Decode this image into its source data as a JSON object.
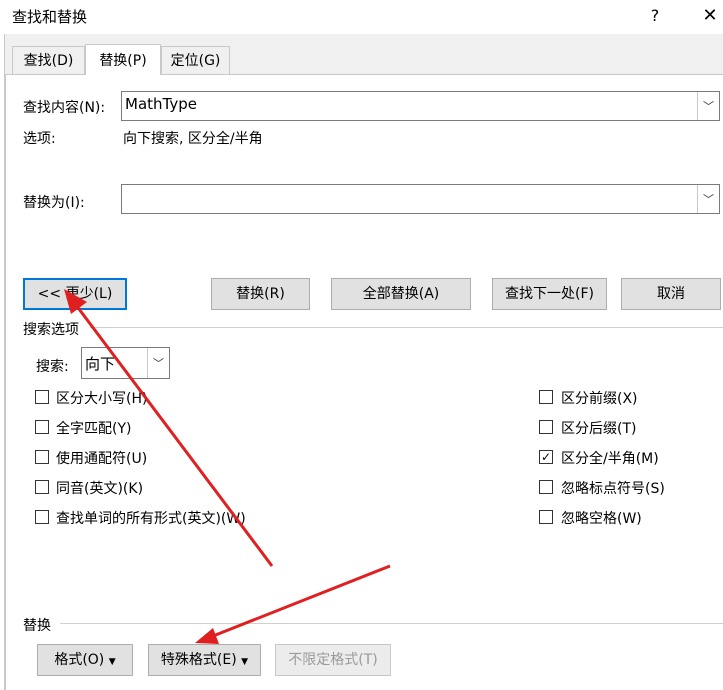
{
  "window": {
    "title": "查找和替换",
    "help": "?",
    "close": "✕"
  },
  "tabs": [
    {
      "label": "查找(D)",
      "active": false
    },
    {
      "label": "替换(P)",
      "active": true
    },
    {
      "label": "定位(G)",
      "active": false
    }
  ],
  "find": {
    "label": "查找内容(N):",
    "value": "MathType",
    "options_label": "选项:",
    "options_value": "向下搜索, 区分全/半角"
  },
  "replace": {
    "label": "替换为(I):",
    "value": ""
  },
  "buttons": {
    "less": "<< 更少(L)",
    "replace": "替换(R)",
    "replace_all": "全部替换(A)",
    "find_next": "查找下一处(F)",
    "cancel": "取消"
  },
  "search_options": {
    "title": "搜索选项",
    "search_label": "搜索:",
    "search_value": "向下",
    "left": [
      {
        "label": "区分大小写(H)",
        "checked": false
      },
      {
        "label": "全字匹配(Y)",
        "checked": false
      },
      {
        "label": "使用通配符(U)",
        "checked": false
      },
      {
        "label": "同音(英文)(K)",
        "checked": false
      },
      {
        "label": "查找单词的所有形式(英文)(W)",
        "checked": false
      }
    ],
    "right": [
      {
        "label": "区分前缀(X)",
        "checked": false
      },
      {
        "label": "区分后缀(T)",
        "checked": false
      },
      {
        "label": "区分全/半角(M)",
        "checked": true
      },
      {
        "label": "忽略标点符号(S)",
        "checked": false
      },
      {
        "label": "忽略空格(W)",
        "checked": false
      }
    ]
  },
  "replace_section": {
    "title": "替换",
    "format": "格式(O)",
    "special": "特殊格式(E)",
    "no_format": "不限定格式(T)"
  },
  "annotation": {
    "color": "#e02020"
  }
}
